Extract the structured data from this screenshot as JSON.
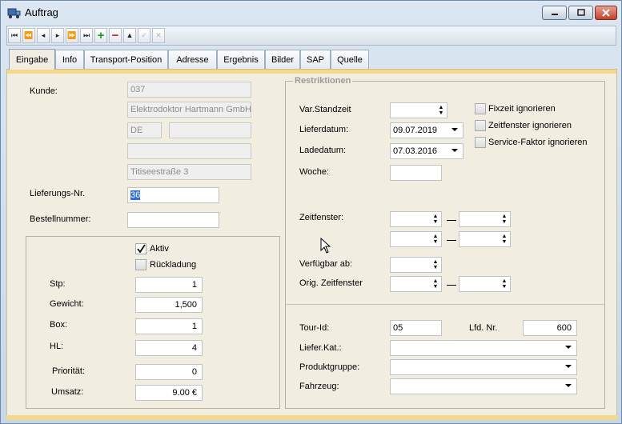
{
  "window": {
    "title": "Auftrag",
    "app_icon": "truck-icon"
  },
  "toolbar": {
    "first": "⏮",
    "prev_fast": "⏪",
    "prev": "◂",
    "next": "▸",
    "next_fast": "⏩",
    "last": "⏭",
    "add": "+",
    "remove": "−",
    "up": "▲",
    "edit": "✓",
    "cancel": "✕"
  },
  "tabs": [
    "Eingabe",
    "Info",
    "Transport-Position",
    "Adresse",
    "Ergebnis",
    "Bilder",
    "SAP",
    "Quelle"
  ],
  "kunde": {
    "label": "Kunde:",
    "nr": "037",
    "name": "Elektrodoktor Hartmann GmbH",
    "country": "DE",
    "zip": "",
    "line4": "",
    "street": "Titiseestraße 3"
  },
  "lieferungs_nr": {
    "label": "Lieferungs-Nr.",
    "value": "36"
  },
  "bestellnummer": {
    "label": "Bestellnummer:",
    "value": ""
  },
  "checks": {
    "aktiv": "Aktiv",
    "rueckladung": "Rückladung"
  },
  "left_fields": [
    {
      "label": "Stp:",
      "value": "1"
    },
    {
      "label": "Gewicht:",
      "value": "1,500"
    },
    {
      "label": "Box:",
      "value": "1"
    },
    {
      "label": "HL:",
      "value": "4"
    },
    {
      "label": "Priorität:",
      "value": "0"
    },
    {
      "label": "Umsatz:",
      "value": "9.00 €"
    }
  ],
  "restriktionen": {
    "title": "Restriktionen",
    "var_standzeit": "Var.Standzeit",
    "lieferdatum_label": "Lieferdatum:",
    "lieferdatum": "09.07.2019",
    "ladedatum_label": "Ladedatum:",
    "ladedatum": "07.03.2016",
    "woche": "Woche:",
    "zeitfenster": "Zeitfenster:",
    "verfuegbar": "Verfügbar ab:",
    "orig_zeitfenster": "Orig. Zeitfenster",
    "fixzeit": "Fixzeit ignorieren",
    "zeitfenster_ign": "Zeitfenster ignorieren",
    "service": "Service-Faktor ignorieren"
  },
  "bottom": {
    "tour_label": "Tour-Id:",
    "tour_value": "05",
    "lfd_label": "Lfd. Nr.",
    "lfd_value": "600",
    "liefer_kat": "Liefer.Kat.:",
    "produktgruppe": "Produktgruppe:",
    "fahrzeug": "Fahrzeug:"
  }
}
